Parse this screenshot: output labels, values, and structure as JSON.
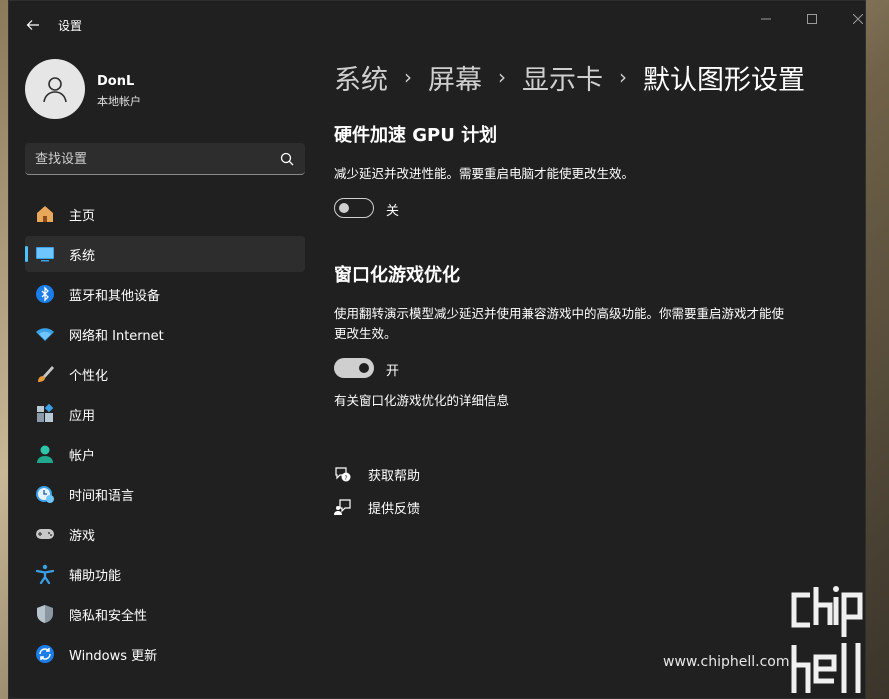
{
  "window": {
    "title": "设置",
    "controls": {
      "minimize_icon": "minimize-icon",
      "maximize_icon": "maximize-icon",
      "close_icon": "close-icon"
    }
  },
  "profile": {
    "name": "DonL",
    "account_type": "本地帐户"
  },
  "search": {
    "placeholder": "查找设置"
  },
  "sidebar": {
    "items": [
      {
        "label": "主页",
        "icon": "home-icon",
        "active": false
      },
      {
        "label": "系统",
        "icon": "system-icon",
        "active": true
      },
      {
        "label": "蓝牙和其他设备",
        "icon": "bluetooth-icon",
        "active": false
      },
      {
        "label": "网络和 Internet",
        "icon": "wifi-icon",
        "active": false
      },
      {
        "label": "个性化",
        "icon": "brush-icon",
        "active": false
      },
      {
        "label": "应用",
        "icon": "apps-icon",
        "active": false
      },
      {
        "label": "帐户",
        "icon": "account-icon",
        "active": false
      },
      {
        "label": "时间和语言",
        "icon": "time-language-icon",
        "active": false
      },
      {
        "label": "游戏",
        "icon": "gamepad-icon",
        "active": false
      },
      {
        "label": "辅助功能",
        "icon": "accessibility-icon",
        "active": false
      },
      {
        "label": "隐私和安全性",
        "icon": "shield-icon",
        "active": false
      },
      {
        "label": "Windows 更新",
        "icon": "update-icon",
        "active": false
      }
    ]
  },
  "breadcrumb": {
    "items": [
      "系统",
      "屏幕",
      "显示卡",
      "默认图形设置"
    ],
    "separator": "›"
  },
  "main": {
    "gpu_scheduling": {
      "title": "硬件加速 GPU 计划",
      "description": "减少延迟并改进性能。需要重启电脑才能使更改生效。",
      "toggle_state": "关",
      "enabled": false
    },
    "windowed_games": {
      "title": "窗口化游戏优化",
      "description": "使用翻转演示模型减少延迟并使用兼容游戏中的高级功能。你需要重启游戏才能使更改生效。",
      "toggle_state": "开",
      "enabled": true,
      "link": "有关窗口化游戏优化的详细信息"
    },
    "help": {
      "get_help": "获取帮助",
      "feedback": "提供反馈"
    }
  },
  "watermark": {
    "url": "www.chiphell.com",
    "logo_text": "chip hell"
  },
  "colors": {
    "accent": "#4cc2ff",
    "window_bg": "#202020",
    "active_item_bg": "#2d2d2d"
  }
}
